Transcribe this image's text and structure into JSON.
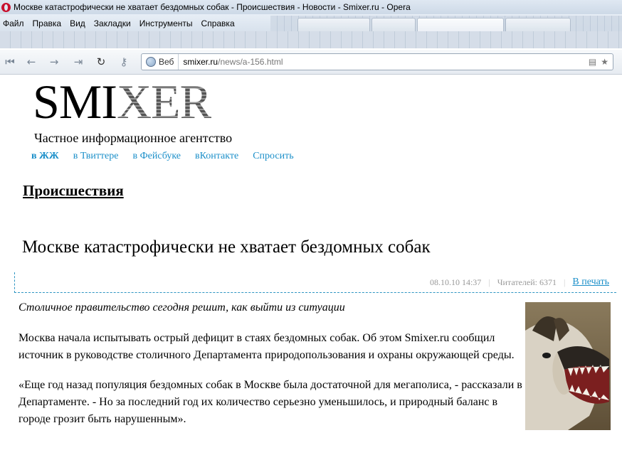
{
  "window": {
    "title": "Москве катастрофически не хватает бездомных собак - Происшествия - Новости - Smixer.ru - Opera"
  },
  "menu": [
    "Файл",
    "Правка",
    "Вид",
    "Закладки",
    "Инструменты",
    "Справка"
  ],
  "address_bar": {
    "mode_label": "Веб",
    "url_host": "smixer.ru",
    "url_path": "/news/a-156.html"
  },
  "site": {
    "logo_part1": "SMI",
    "logo_part2": "XER",
    "tagline": "Частное информационное агентство",
    "social_links": [
      "в ЖЖ",
      "в Твиттере",
      "в Фейсбуке",
      "вКонтакте",
      "Спросить"
    ]
  },
  "article": {
    "section": "Происшествия",
    "headline": "Москве катастрофически не хватает бездомных собак",
    "date": "08.10.10 14:37",
    "readers": "Читателей: 6371",
    "print_label": "В печать",
    "lead": "Столичное правительство сегодня решит, как выйти из ситуации",
    "paragraphs": [
      "Москва начала испытывать острый дефицит в стаях бездомных собак. Об этом Smixer.ru сообщил источник в руководстве столичного Департамента природопользования и охраны окружающей среды.",
      "«Еще год назад популяция бездомных собак в Москве была достаточной для мегаполиса, - рассказали в Департаменте. - Но за последний год их количество серьезно уменьшилось, и природный баланс в городе грозит быть нарушенным»."
    ]
  },
  "colors": {
    "link": "#1b8fc9",
    "meta": "#999999",
    "divider": "#2d95c2"
  }
}
